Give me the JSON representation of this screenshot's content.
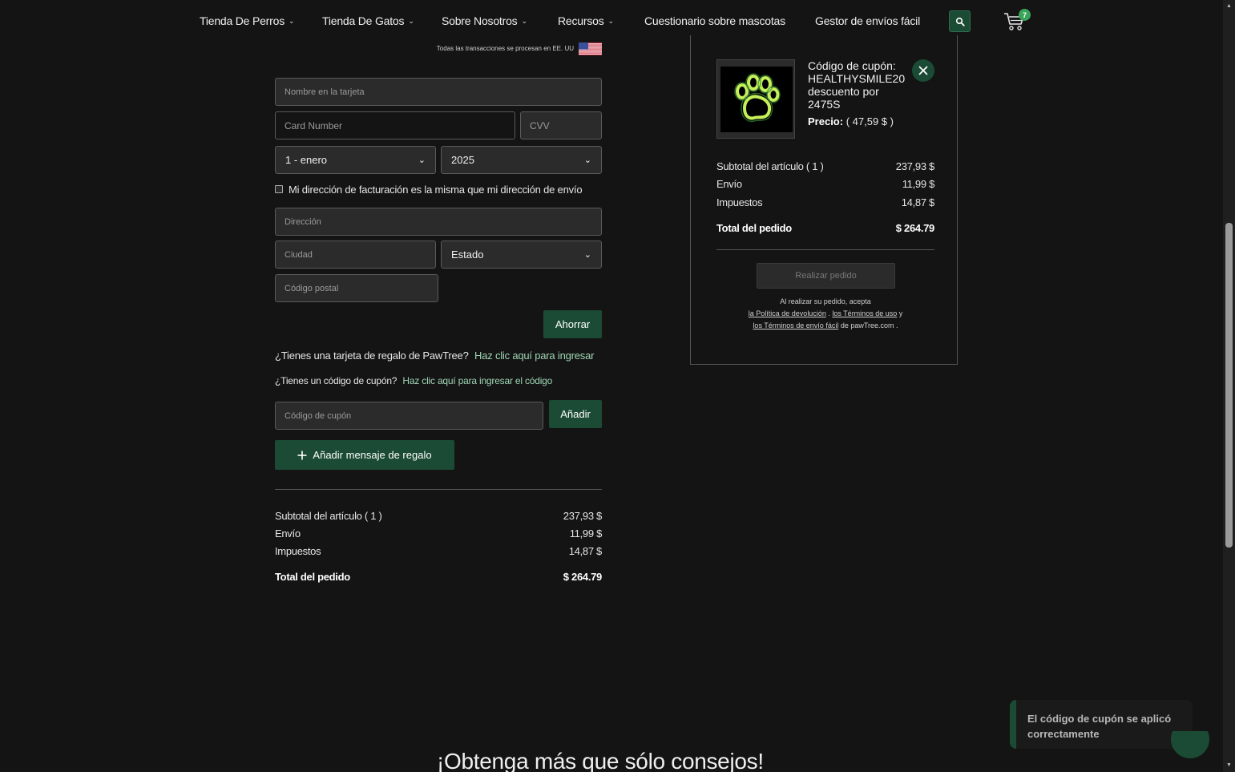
{
  "nav": {
    "items": [
      {
        "label": "Tienda De Perros",
        "dropdown": true
      },
      {
        "label": "Tienda De Gatos",
        "dropdown": true
      },
      {
        "label": "Sobre Nosotros",
        "dropdown": true
      },
      {
        "label": "Recursos",
        "dropdown": true
      },
      {
        "label": "Cuestionario sobre mascotas",
        "dropdown": false
      },
      {
        "label": "Gestor de envíos fácil",
        "dropdown": false
      }
    ],
    "cart_count": "7",
    "search_icon": "search-icon",
    "cart_icon": "cart-icon"
  },
  "payment": {
    "transactions_note": "Todas las transacciones se procesan en EE. UU",
    "name_placeholder": "Nombre en la tarjeta",
    "card_number_placeholder": "Card Number",
    "cvv_placeholder": "CVV",
    "month_value": "1 - enero",
    "year_value": "2025",
    "billing_same_label": "Mi dirección de facturación es la misma que mi dirección de envío",
    "address_placeholder": "Dirección",
    "city_placeholder": "Ciudad",
    "state_value": "Estado",
    "zip_placeholder": "Código postal",
    "save_label": "Ahorrar"
  },
  "gift": {
    "gift_card_question": "¿Tienes una tarjeta de regalo de PawTree?",
    "gift_card_link": "Haz clic aquí para ingresar",
    "coupon_question": "¿Tienes un código de cupón?",
    "coupon_link": "Haz clic aquí para ingresar el código",
    "coupon_placeholder": "Código de cupón",
    "add_label": "Añadir",
    "gift_message_label": "Añadir mensaje de regalo"
  },
  "summary": {
    "subtotal_label": "Subtotal del artículo ( 1 )",
    "subtotal_value": "237,93 $",
    "shipping_label": "Envío",
    "shipping_value": "11,99 $",
    "taxes_label": "Impuestos",
    "taxes_value": "14,87 $",
    "total_label": "Total del pedido",
    "total_value": "$ 264.79"
  },
  "sidebar": {
    "coupon_title": "Código de cupón: HEALTHYSMILE20 descuento por 2475S",
    "price_label": "Precio:",
    "price_value": "( 47,59 $ )",
    "place_order_label": "Realizar pedido",
    "legal_prefix": "Al realizar su pedido, acepta",
    "legal_return_policy": "la Política de devolución",
    "legal_terms_of_use": "los Términos de uso",
    "legal_and": "y",
    "legal_shipping_terms": "los Términos de envío fácil",
    "legal_suffix": "de pawTree.com ."
  },
  "toast": {
    "message": "El código de cupón se aplicó correctamente"
  },
  "footer": {
    "heading": "¡Obtenga más que sólo consejos!"
  },
  "colors": {
    "background": "#141414",
    "brand_green": "#1b4b34",
    "link_green": "#9fd6b4"
  }
}
